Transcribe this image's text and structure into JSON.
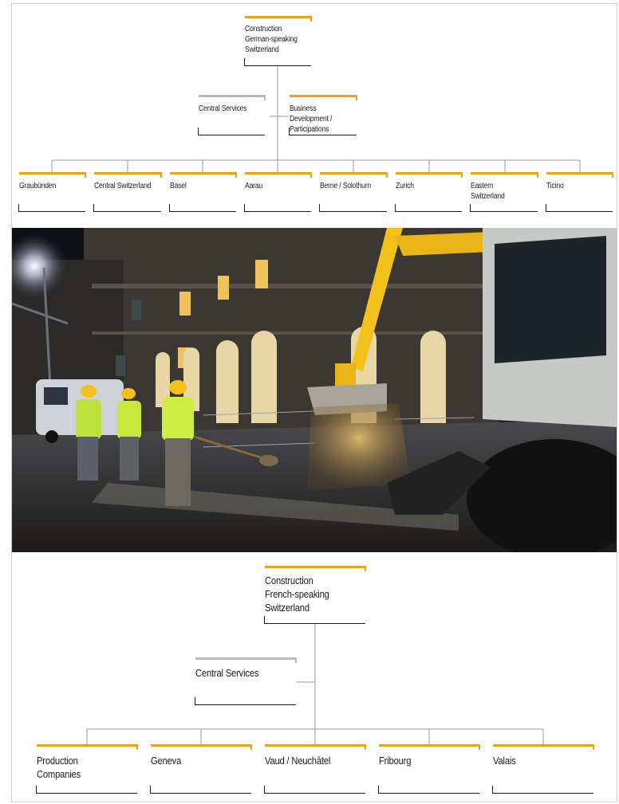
{
  "top_chart": {
    "root": [
      "Construction",
      "German-speaking",
      "Switzerland"
    ],
    "staff": [
      {
        "lines": [
          "Central Services"
        ],
        "style": "grey"
      },
      {
        "lines": [
          "Business Development /",
          "Participations"
        ],
        "style": "orange"
      }
    ],
    "regions": [
      "Graubünden",
      "Central Switzerland",
      "Basel",
      "Aarau",
      "Berne / Solothurn",
      "Zurich",
      "Eastern Switzerland",
      "Ticino"
    ]
  },
  "photo": {
    "description_icon": "night-road-construction-photo"
  },
  "bottom_chart": {
    "root": [
      "Construction",
      "French-speaking",
      "Switzerland"
    ],
    "staff": [
      {
        "lines": [
          "Central Services"
        ],
        "style": "grey"
      }
    ],
    "regions": [
      "Production Companies",
      "Geneva",
      "Vaud / Neuchâtel",
      "Fribourg",
      "Valais"
    ]
  },
  "colors": {
    "accent": "#e8a21b",
    "grey_accent": "#b9b9b9",
    "line": "#1a1a1a",
    "connector": "#9a9a9a"
  }
}
